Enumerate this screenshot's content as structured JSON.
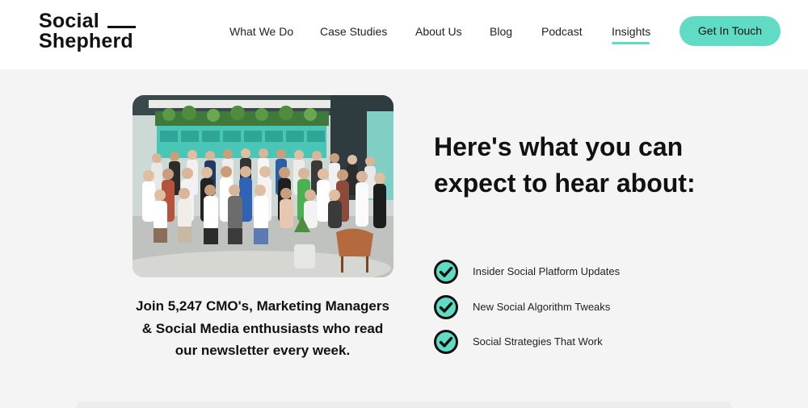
{
  "brand": {
    "line1": "Social",
    "line2": "Shepherd",
    "accent": "#5fdcc3"
  },
  "nav": {
    "items": [
      {
        "label": "What We Do"
      },
      {
        "label": "Case Studies"
      },
      {
        "label": "About Us"
      },
      {
        "label": "Blog"
      },
      {
        "label": "Podcast"
      },
      {
        "label": "Insights",
        "active": true
      }
    ],
    "cta_label": "Get In Touch"
  },
  "main": {
    "photo_alt": "",
    "caption": "Join 5,247 CMO's, Marketing Managers & Social Media enthusiasts who read our newsletter every week.",
    "headline": "Here's what you can expect to hear about:",
    "benefits": [
      {
        "label": "Insider Social Platform Updates",
        "icon": "check-circle-icon"
      },
      {
        "label": "New Social Algorithm Tweaks",
        "icon": "check-circle-icon"
      },
      {
        "label": "Social Strategies That Work",
        "icon": "check-circle-icon"
      }
    ]
  },
  "colors": {
    "accent": "#5fdcc3",
    "text": "#111111",
    "background": "#f4f4f4",
    "header_bg": "#ffffff"
  }
}
